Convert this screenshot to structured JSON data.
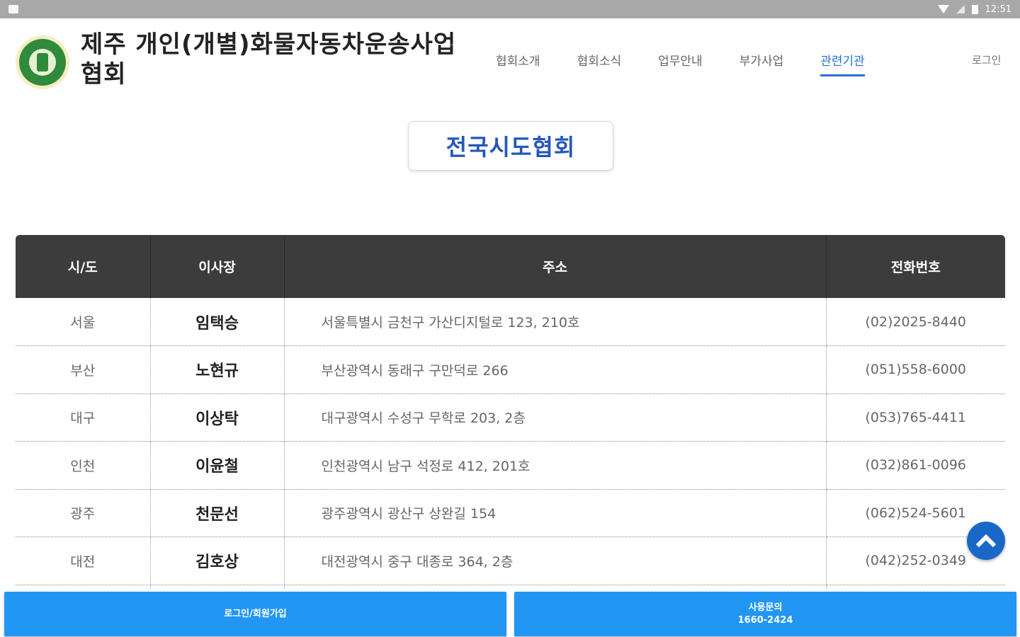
{
  "status_bar": {
    "time": "12:51"
  },
  "header": {
    "title": "제주 개인(개별)화물자동차운송사업 협회",
    "nav": [
      "협회소개",
      "협회소식",
      "업무안내",
      "부가사업",
      "관련기관"
    ],
    "active_nav": "관련기관",
    "login_label": "로그인"
  },
  "page": {
    "heading": "전국시도협회"
  },
  "table": {
    "headers": {
      "region": "시/도",
      "chairman": "이사장",
      "address": "주소",
      "phone": "전화번호"
    },
    "rows": [
      {
        "region": "서울",
        "chairman": "임택승",
        "address": "서울특별시 금천구 가산디지털로 123, 210호",
        "phone": "(02)2025-8440"
      },
      {
        "region": "부산",
        "chairman": "노현규",
        "address": "부산광역시 동래구 구만덕로 266",
        "phone": "(051)558-6000"
      },
      {
        "region": "대구",
        "chairman": "이상탁",
        "address": "대구광역시 수성구 무학로 203, 2층",
        "phone": "(053)765-4411"
      },
      {
        "region": "인천",
        "chairman": "이윤철",
        "address": "인천광역시 남구 석정로 412, 201호",
        "phone": "(032)861-0096"
      },
      {
        "region": "광주",
        "chairman": "천문선",
        "address": "광주광역시 광산구 상완길 154",
        "phone": "(062)524-5601"
      },
      {
        "region": "대전",
        "chairman": "김호상",
        "address": "대전광역시 중구 대종로 364, 2층",
        "phone": "(042)252-0349"
      }
    ]
  },
  "bottom_bar": {
    "left_label": "로그인/회원가입",
    "right_label": "사용문의",
    "right_phone": "1660-2424"
  },
  "colors": {
    "accent": "#2196f3",
    "nav_active": "#2a6fd1",
    "header_bg": "#3c3c3c",
    "heading_text": "#2557b8"
  }
}
